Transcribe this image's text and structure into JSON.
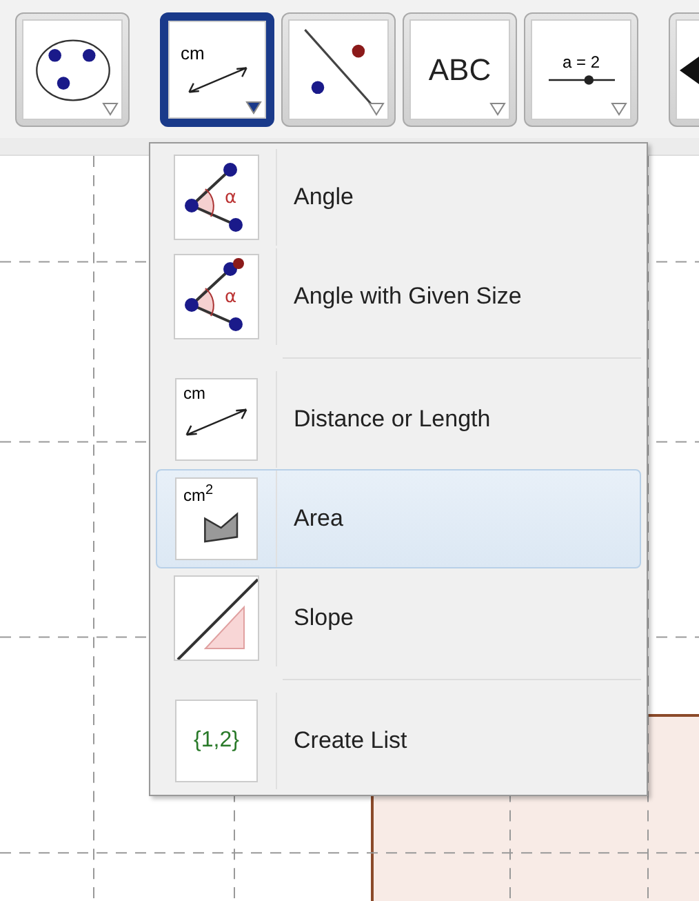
{
  "toolbar": [
    {
      "kind": "circle-points",
      "selected": false
    },
    {
      "kind": "distance",
      "text": "cm",
      "selected": true
    },
    {
      "kind": "line-point",
      "selected": false
    },
    {
      "kind": "text",
      "text": "ABC",
      "selected": false
    },
    {
      "kind": "slider",
      "text": "a = 2",
      "selected": false
    },
    {
      "kind": "move",
      "selected": false
    }
  ],
  "menu": {
    "groups": [
      [
        {
          "kind": "angle",
          "icon_text": "α",
          "label": "Angle",
          "selected": false
        },
        {
          "kind": "angle-size",
          "icon_text": "α",
          "label": "Angle with Given Size",
          "selected": false
        }
      ],
      [
        {
          "kind": "distance",
          "icon_text": "cm",
          "label": "Distance or Length",
          "selected": false
        },
        {
          "kind": "area",
          "icon_text": "cm$^{2}$",
          "label": "Area",
          "selected": true
        },
        {
          "kind": "slope",
          "label": "Slope",
          "selected": false
        }
      ],
      [
        {
          "kind": "list",
          "icon_text": "{1,2}",
          "label": "Create List",
          "selected": false
        }
      ]
    ]
  }
}
